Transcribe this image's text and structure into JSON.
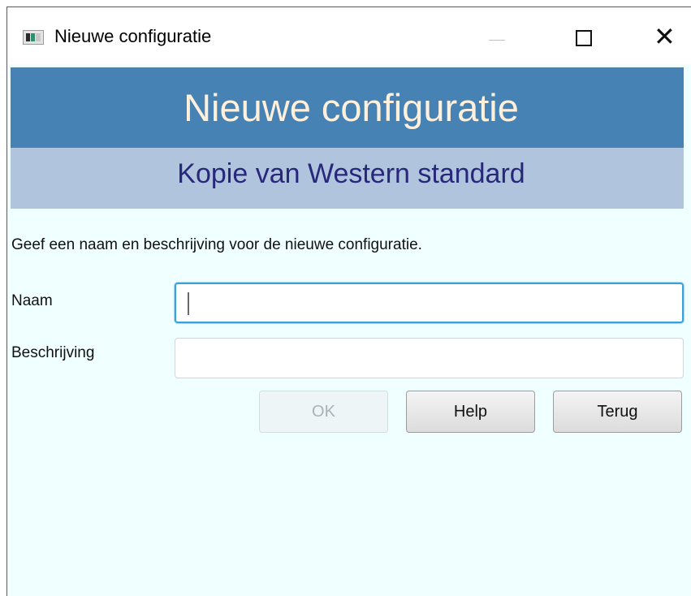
{
  "window": {
    "title": "Nieuwe configuratie",
    "icon": "app-window-icon",
    "controls": {
      "minimize": "minimize-icon",
      "maximize": "maximize-icon",
      "close": "close-icon"
    }
  },
  "header": {
    "title": "Nieuwe configuratie",
    "subtitle": "Kopie van Western standard",
    "title_bg": "#4682b4",
    "subtitle_bg": "#b0c4de"
  },
  "form": {
    "instruction": "Geef een naam en beschrijving voor de nieuwe configuratie.",
    "name_label": "Naam",
    "name_value": "",
    "description_label": "Beschrijving",
    "description_value": ""
  },
  "buttons": {
    "ok": "OK",
    "help": "Help",
    "back": "Terug"
  },
  "colors": {
    "background": "#f0ffff",
    "focus_border": "#39a3d9"
  }
}
